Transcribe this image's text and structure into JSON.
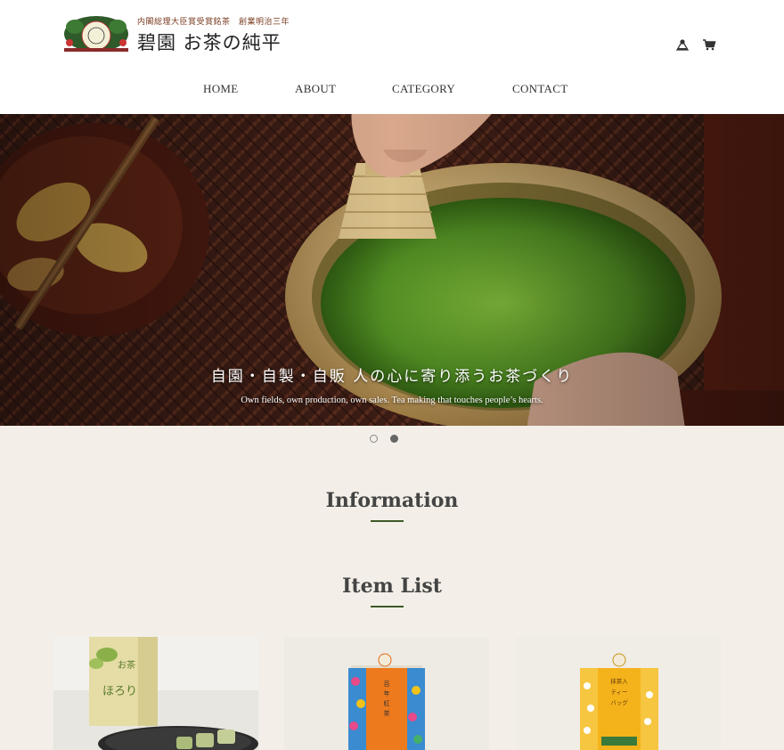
{
  "header": {
    "logo_sub": "内閣総理大臣賞受賞銘茶　創業明治三年",
    "logo_main": "碧園 お茶の純平",
    "nav": [
      {
        "label": "HOME"
      },
      {
        "label": "ABOUT"
      },
      {
        "label": "CATEGORY"
      },
      {
        "label": "CONTACT"
      }
    ],
    "icons": [
      "account-icon",
      "cart-icon"
    ]
  },
  "hero": {
    "title": "自園・自製・自販 人の心に寄り添うお茶づくり",
    "subtitle": "Own fields, own production, own sales. Tea making that touches people’s hearts.",
    "slide_count": 2,
    "active_slide": 2
  },
  "sections": {
    "information": "Information",
    "item_list": "Item List"
  },
  "items": [
    {
      "name": "お茶ほろり",
      "image": "matcha-sweets-box"
    },
    {
      "name": "百年紅茶",
      "image": "orange-tea-pack"
    },
    {
      "name": "抹茶入 ティーバッグ",
      "image": "yellow-tea-pack"
    }
  ],
  "colors": {
    "accent": "#3d5a27",
    "background": "#f3efe8"
  }
}
